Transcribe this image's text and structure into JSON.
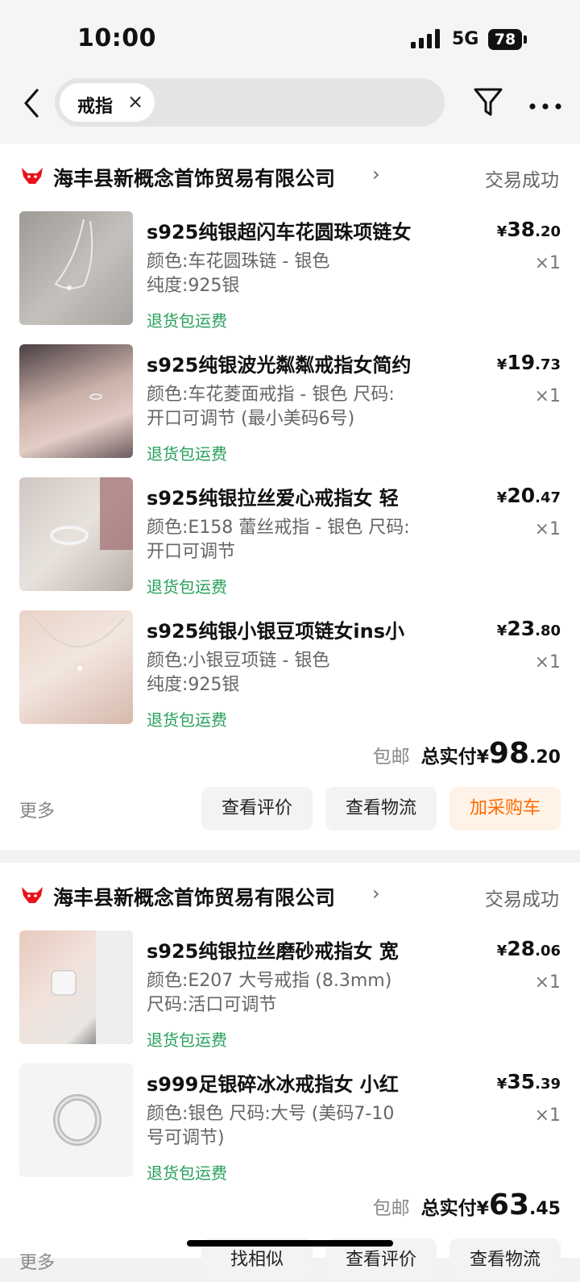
{
  "status": {
    "time": "10:00",
    "network": "5G",
    "battery": "78"
  },
  "search": {
    "chip": "戒指",
    "chip_close": "×"
  },
  "orders": [
    {
      "shop": "海丰县新概念首饰贸易有限公司",
      "status": "交易成功",
      "items": [
        {
          "name": "s925纯银超闪车花圆珠项链女",
          "spec1": "颜色:车花圆珠链 - 银色",
          "spec2": "纯度:925银",
          "return": "退货包运费",
          "price_int": "38",
          "price_dec": ".20",
          "qty": "×1"
        },
        {
          "name": "s925纯银波光粼粼戒指女简约",
          "spec1": "颜色:车花菱面戒指 - 银色 尺码:",
          "spec2": "开口可调节 (最小美码6号)",
          "return": "退货包运费",
          "price_int": "19",
          "price_dec": ".73",
          "qty": "×1"
        },
        {
          "name": "s925纯银拉丝爱心戒指女 轻",
          "spec1": "颜色:E158 蕾丝戒指 - 银色 尺码:",
          "spec2": "开口可调节",
          "return": "退货包运费",
          "price_int": "20",
          "price_dec": ".47",
          "qty": "×1"
        },
        {
          "name": "s925纯银小银豆项链女ins小",
          "spec1": "颜色:小银豆项链 - 银色",
          "spec2": "纯度:925银",
          "return": "退货包运费",
          "price_int": "23",
          "price_dec": ".80",
          "qty": "×1"
        }
      ],
      "shipping": "包邮",
      "total_label": "总实付",
      "currency": "¥",
      "total_int": "98",
      "total_dec": ".20",
      "more": "更多",
      "buttons": [
        "查看评价",
        "查看物流",
        "加采购车"
      ]
    },
    {
      "shop": "海丰县新概念首饰贸易有限公司",
      "status": "交易成功",
      "items": [
        {
          "name": "s925纯银拉丝磨砂戒指女 宽",
          "spec1": "颜色:E207  大号戒指 (8.3mm)",
          "spec2": "尺码:活口可调节",
          "return": "退货包运费",
          "price_int": "28",
          "price_dec": ".06",
          "qty": "×1"
        },
        {
          "name": "s999足银碎冰冰戒指女 小红",
          "spec1": "颜色:银色 尺码:大号 (美码7-10",
          "spec2": "号可调节)",
          "return": "退货包运费",
          "price_int": "35",
          "price_dec": ".39",
          "qty": "×1"
        }
      ],
      "shipping": "包邮",
      "total_label": "总实付",
      "currency": "¥",
      "total_int": "63",
      "total_dec": ".45",
      "more": "更多",
      "buttons": [
        "找相似",
        "查看评价",
        "查看物流"
      ]
    }
  ],
  "colors": {
    "accent_orange": "#ff6a00",
    "green": "#27a05a",
    "logo_red": "#e8131b"
  },
  "icons": [
    "back-icon",
    "filter-icon",
    "more-icon",
    "shop-logo-icon",
    "chevron-right-icon"
  ]
}
